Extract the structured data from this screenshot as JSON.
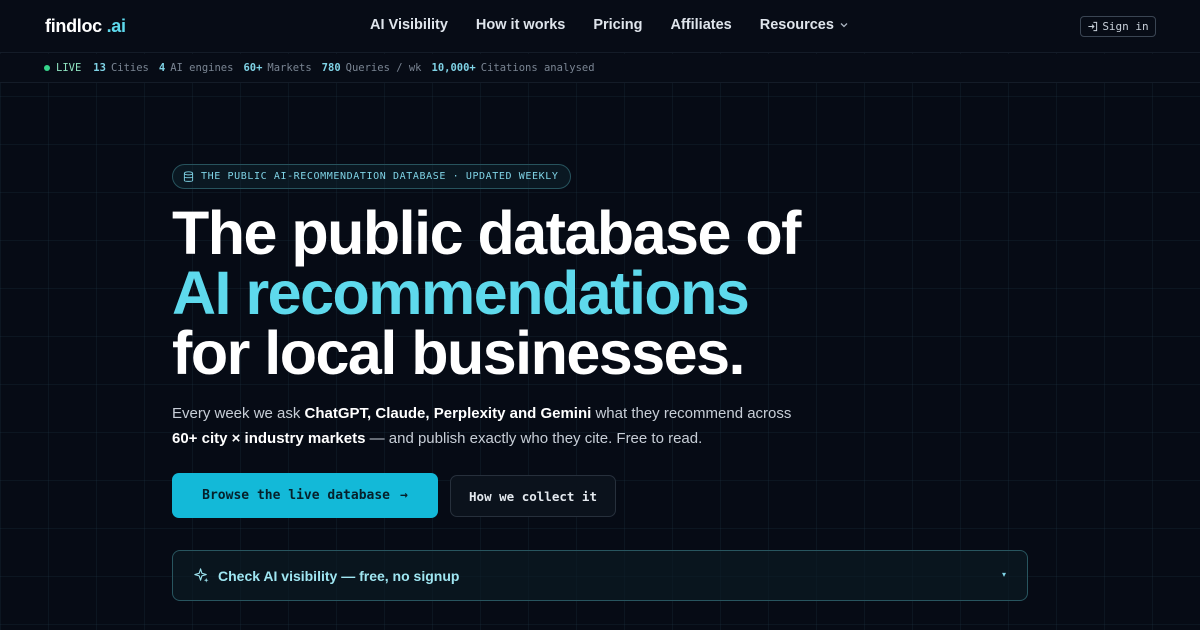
{
  "header": {
    "logo_main": "findloc",
    "logo_accent": ".ai",
    "nav": [
      "AI Visibility",
      "How it works",
      "Pricing",
      "Affiliates",
      "Resources"
    ],
    "signin_label": "Sign in"
  },
  "stats": {
    "live_label": "LIVE",
    "items": [
      {
        "num": "13",
        "label": "Cities"
      },
      {
        "num": "4",
        "label": "AI engines"
      },
      {
        "num": "60+",
        "label": "Markets"
      },
      {
        "num": "780",
        "label": "Queries / wk"
      },
      {
        "num": "10,000+",
        "label": "Citations analysed"
      }
    ]
  },
  "hero": {
    "badge": "THE PUBLIC AI-RECOMMENDATION DATABASE · UPDATED WEEKLY",
    "headline_line1": "The public database of",
    "headline_line2": "AI recommendations",
    "headline_line3": "for local businesses.",
    "sub_1": "Every week we ask ",
    "sub_engines": "ChatGPT, Claude, Perplexity and Gemini",
    "sub_2": " what they recommend across ",
    "sub_markets": "60+ city × industry markets",
    "sub_3": " — and publish exactly who they cite. Free to read.",
    "primary_button": "Browse the live database",
    "primary_arrow": "→",
    "secondary_button": "How we collect it",
    "check_label": "Check AI visibility — free, no signup",
    "check_caret": "▾"
  },
  "colors": {
    "accent": "#5ed9ec",
    "button": "#13b9d8",
    "background": "#060b15",
    "live": "#36d58b"
  }
}
